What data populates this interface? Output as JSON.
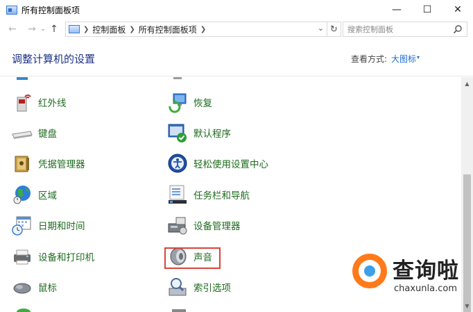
{
  "window": {
    "title": "所有控制面板项",
    "buttons": {
      "minimize": "—",
      "maximize": "☐",
      "close": "✕"
    }
  },
  "nav": {
    "back": "←",
    "forward": "→",
    "history": "⌄",
    "up": "↑"
  },
  "address": {
    "crumbs": [
      "控制面板",
      "所有控制面板项"
    ],
    "dropdown": "⌄",
    "refresh": "↻"
  },
  "search": {
    "placeholder": "搜索控制面板"
  },
  "header": {
    "title": "调整计算机的设置",
    "view_label": "查看方式:",
    "view_value": "大图标",
    "view_caret": "▾"
  },
  "items": {
    "left": [
      {
        "label": "红外线",
        "icon": "infrared-icon"
      },
      {
        "label": "键盘",
        "icon": "keyboard-icon"
      },
      {
        "label": "凭据管理器",
        "icon": "credential-manager-icon"
      },
      {
        "label": "区域",
        "icon": "globe-icon"
      },
      {
        "label": "日期和时间",
        "icon": "calendar-clock-icon"
      },
      {
        "label": "设备和打印机",
        "icon": "printer-icon"
      },
      {
        "label": "鼠标",
        "icon": "mouse-icon"
      }
    ],
    "right": [
      {
        "label": "恢复",
        "icon": "recovery-icon"
      },
      {
        "label": "默认程序",
        "icon": "default-programs-icon"
      },
      {
        "label": "轻松使用设置中心",
        "icon": "ease-of-access-icon"
      },
      {
        "label": "任务栏和导航",
        "icon": "taskbar-icon"
      },
      {
        "label": "设备管理器",
        "icon": "device-manager-icon"
      },
      {
        "label": "声音",
        "icon": "speaker-icon"
      },
      {
        "label": "索引选项",
        "icon": "indexing-options-icon"
      }
    ]
  },
  "scrollbar": {
    "up": "▲",
    "down": "▼"
  },
  "watermark": {
    "cn": "查询啦",
    "en": "chaxunla.com"
  },
  "colors": {
    "item_text": "#1f6b1f",
    "title_text": "#1e3287",
    "link": "#1a6ad6",
    "highlight": "#d9433a"
  }
}
